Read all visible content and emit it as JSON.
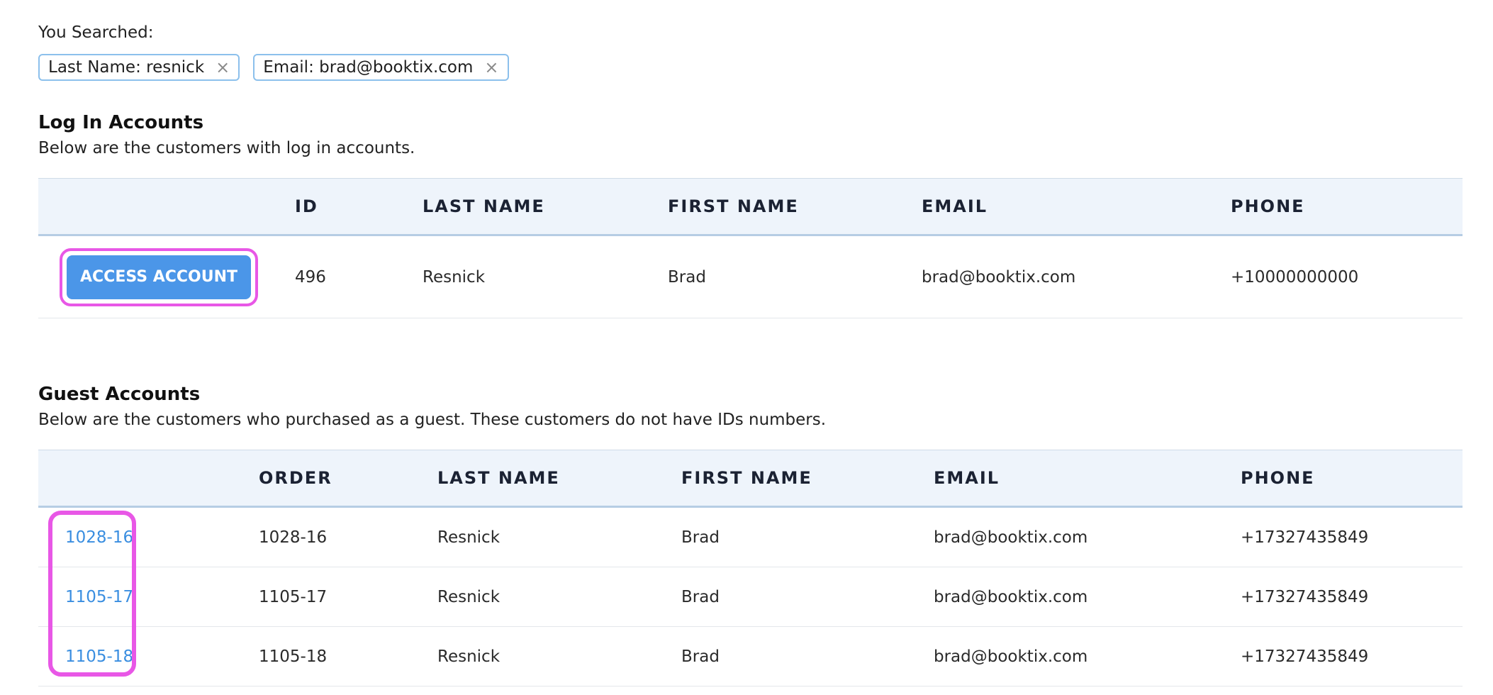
{
  "search": {
    "label": "You Searched:",
    "chips": [
      {
        "text": "Last Name: resnick",
        "remove": "×"
      },
      {
        "text": "Email: brad@booktix.com",
        "remove": "×"
      }
    ]
  },
  "login_accounts": {
    "title": "Log In Accounts",
    "description": "Below are the customers with log in accounts.",
    "columns": [
      "",
      "ID",
      "LAST NAME",
      "FIRST NAME",
      "EMAIL",
      "PHONE"
    ],
    "rows": [
      {
        "action": "ACCESS ACCOUNT",
        "id": "496",
        "last_name": "Resnick",
        "first_name": "Brad",
        "email": "brad@booktix.com",
        "phone": "+10000000000"
      }
    ]
  },
  "guest_accounts": {
    "title": "Guest Accounts",
    "description": "Below are the customers who purchased as a guest. These customers do not have IDs numbers.",
    "columns": [
      "",
      "ORDER",
      "LAST NAME",
      "FIRST NAME",
      "EMAIL",
      "PHONE"
    ],
    "rows": [
      {
        "link": "1028-16",
        "order": "1028-16",
        "last_name": "Resnick",
        "first_name": "Brad",
        "email": "brad@booktix.com",
        "phone": "+17327435849"
      },
      {
        "link": "1105-17",
        "order": "1105-17",
        "last_name": "Resnick",
        "first_name": "Brad",
        "email": "brad@booktix.com",
        "phone": "+17327435849"
      },
      {
        "link": "1105-18",
        "order": "1105-18",
        "last_name": "Resnick",
        "first_name": "Brad",
        "email": "brad@booktix.com",
        "phone": "+17327435849"
      }
    ]
  },
  "colors": {
    "accent": "#4b96e8",
    "link": "#3a8ee0",
    "highlight": "#e857e6",
    "header_bg": "#eef4fb"
  }
}
